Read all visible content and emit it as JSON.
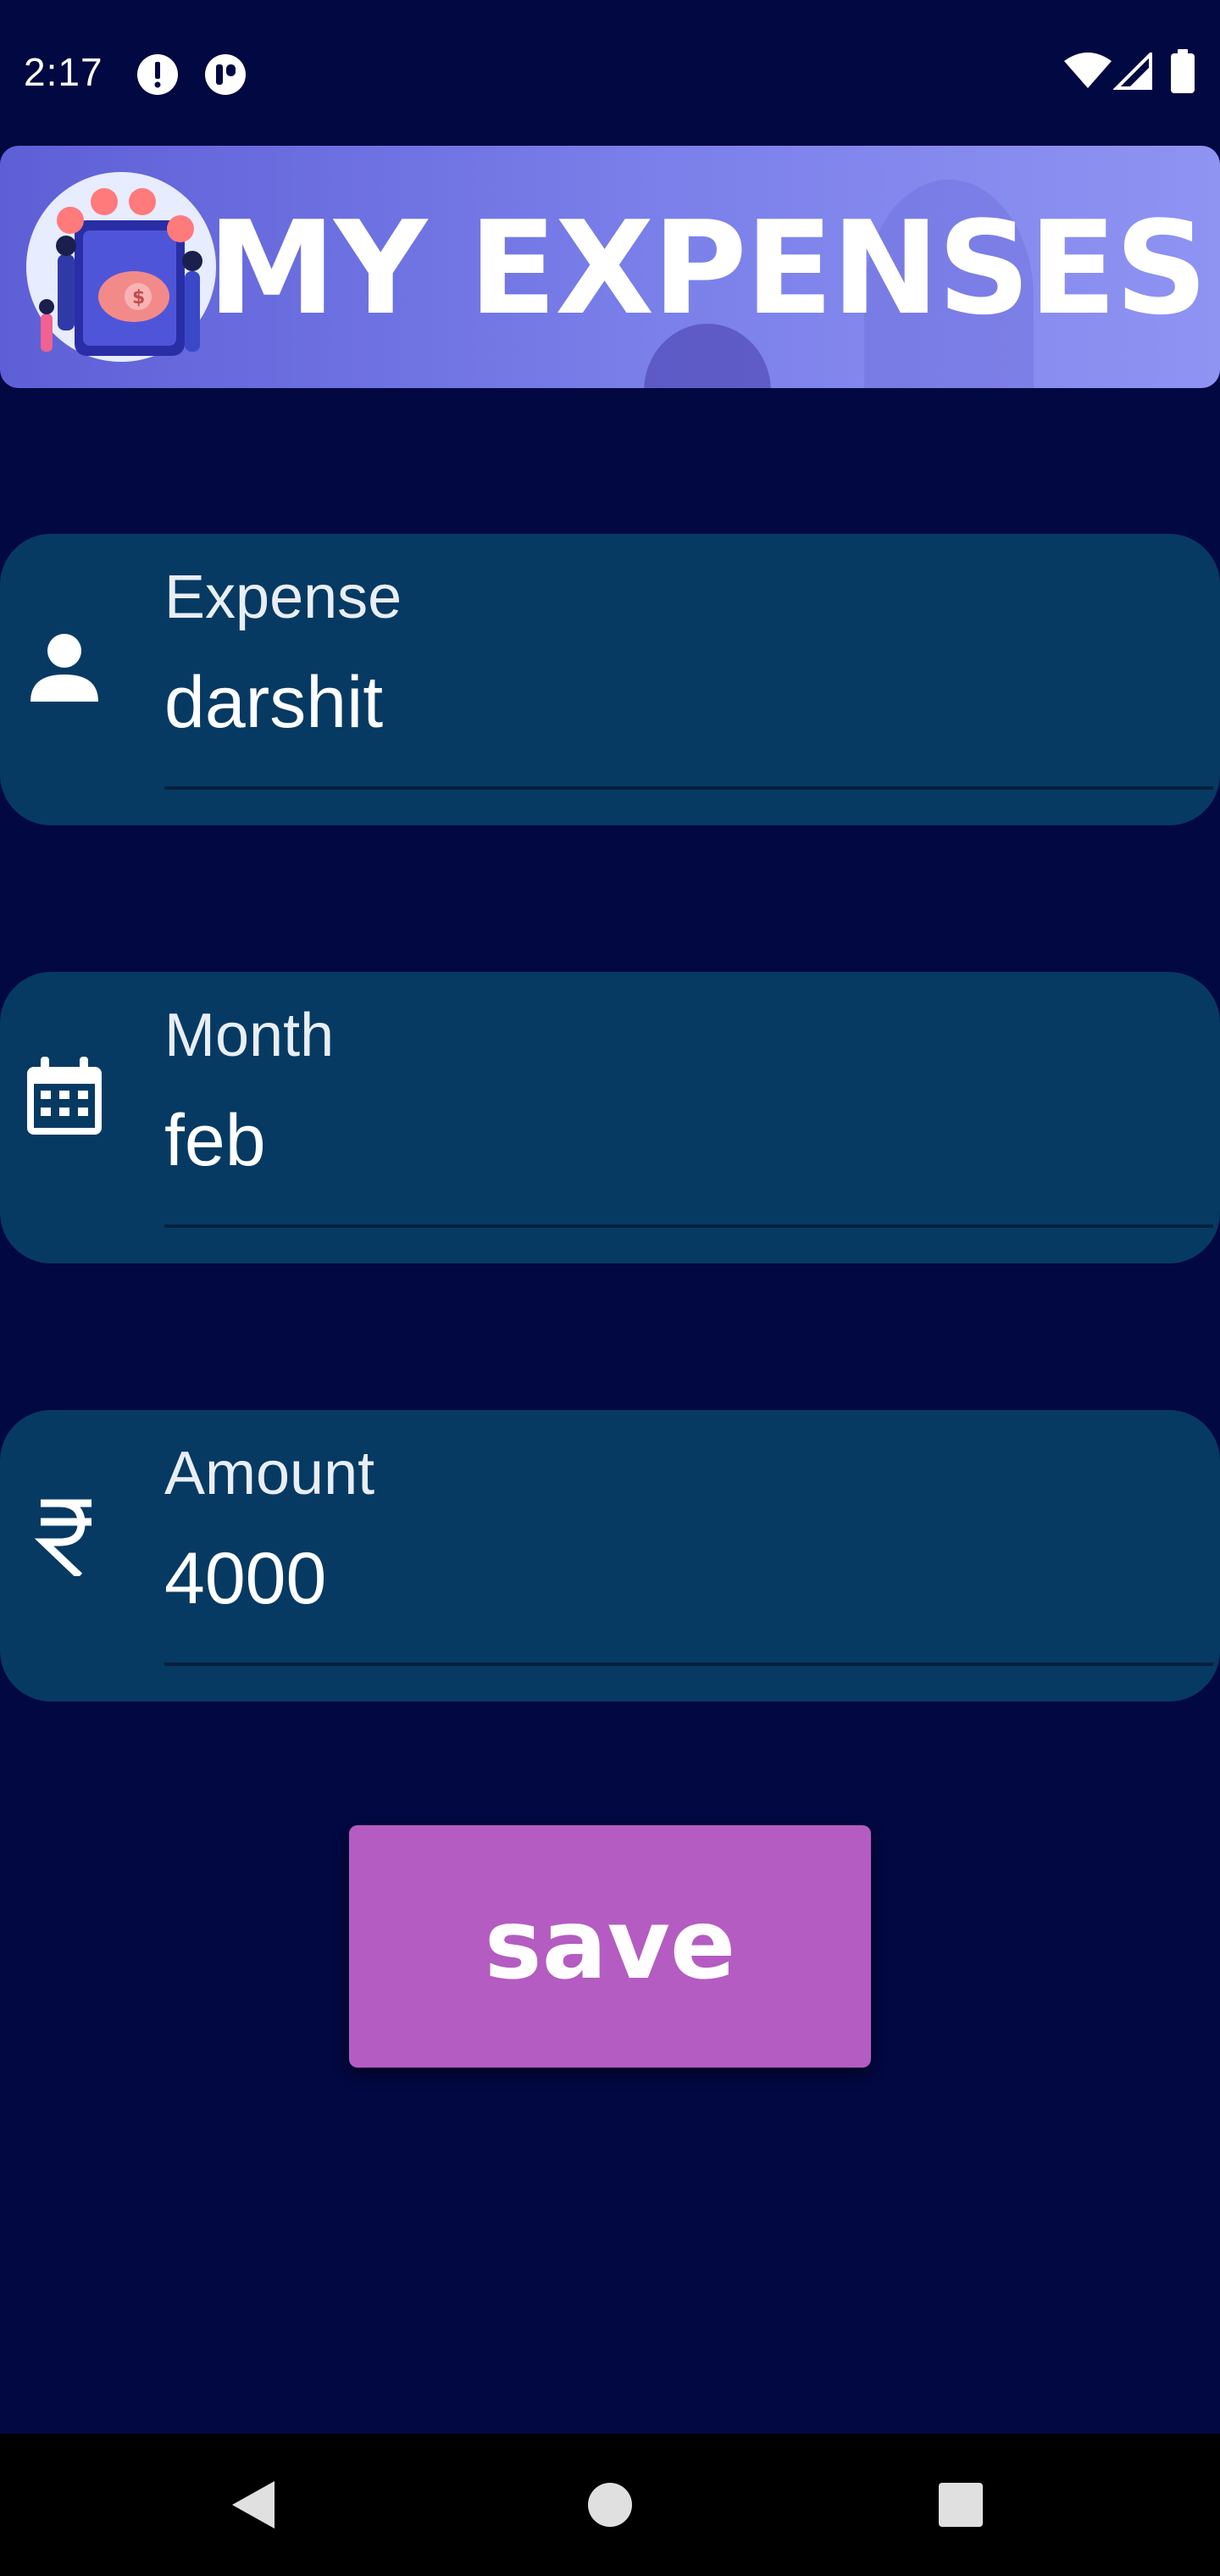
{
  "status_bar": {
    "time": "2:17",
    "left_icons": [
      "alert-circle-icon",
      "notification-app-icon"
    ],
    "right_icons": [
      "wifi-icon",
      "signal-icon",
      "battery-icon"
    ]
  },
  "header": {
    "title": "MY EXPENSES",
    "illustration": "family-savings-illustration"
  },
  "form": {
    "expense": {
      "label": "Expense",
      "value": "darshit",
      "icon": "person-icon"
    },
    "month": {
      "label": "Month",
      "value": "feb",
      "icon": "calendar-icon"
    },
    "amount": {
      "label": "Amount",
      "value": "4000",
      "icon": "rupee-icon"
    }
  },
  "save_button": {
    "label": "save"
  },
  "nav_bar": {
    "buttons": [
      "back-icon",
      "home-icon",
      "recents-icon"
    ]
  },
  "colors": {
    "background": "#020841",
    "card": "#063a63",
    "header_start": "#5e5fd6",
    "header_end": "#8f93f2",
    "button": "#b45cc1"
  }
}
